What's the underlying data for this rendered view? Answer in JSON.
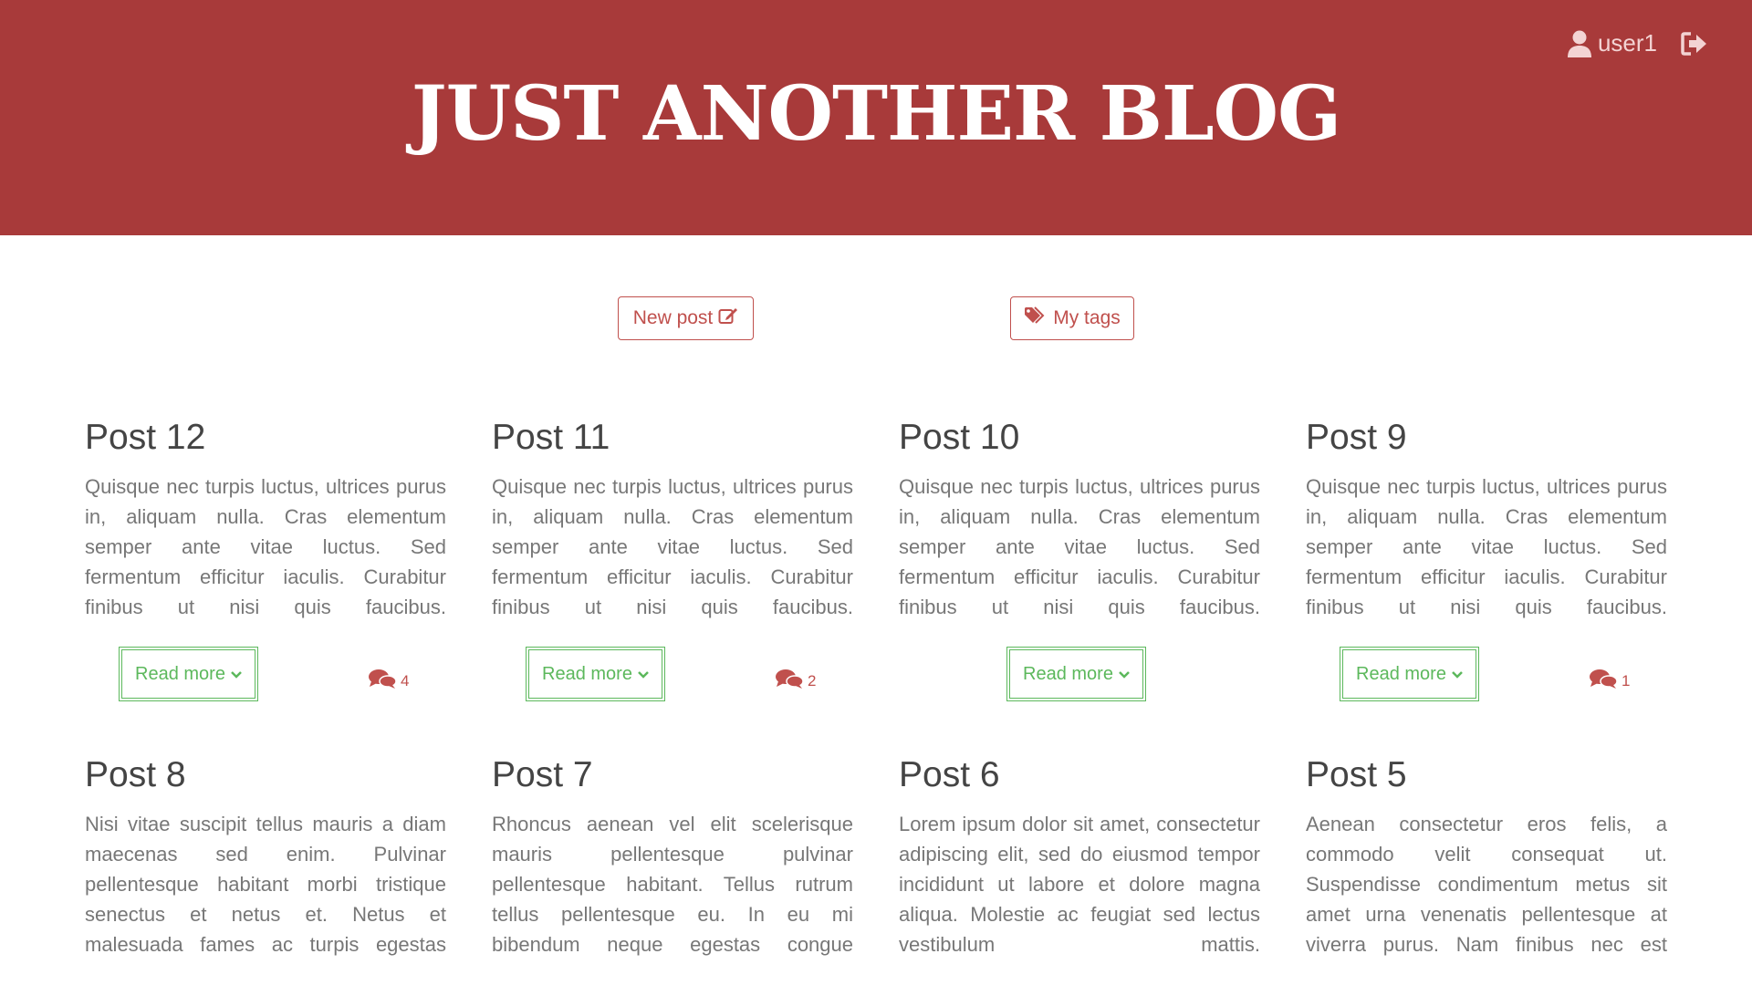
{
  "header": {
    "title": "JUST ANOTHER BLOG",
    "username": "user1",
    "background": "#a83a3a"
  },
  "actions": {
    "new_post_label": "New post",
    "my_tags_label": "My tags"
  },
  "colors": {
    "accent": "#c0504d",
    "read_more": "#5cb85c"
  },
  "posts": [
    {
      "title": "Post 12",
      "body": "Quisque nec turpis luctus, ultrices purus in, aliquam nulla. Cras elementum semper ante vitae luctus. Sed fermentum efficitur iaculis. Curabitur finibus ut nisi quis faucibus.",
      "read_more": "Read more",
      "comments": "4"
    },
    {
      "title": "Post 11",
      "body": "Quisque nec turpis luctus, ultrices purus in, aliquam nulla. Cras elementum semper ante vitae luctus. Sed fermentum efficitur iaculis. Curabitur finibus ut nisi quis faucibus.",
      "read_more": "Read more",
      "comments": "2"
    },
    {
      "title": "Post 10",
      "body": "Quisque nec turpis luctus, ultrices purus in, aliquam nulla. Cras elementum semper ante vitae luctus. Sed fermentum efficitur iaculis. Curabitur finibus ut nisi quis faucibus.",
      "read_more": "Read more",
      "comments": ""
    },
    {
      "title": "Post 9",
      "body": "Quisque nec turpis luctus, ultrices purus in, aliquam nulla. Cras elementum semper ante vitae luctus. Sed fermentum efficitur iaculis. Curabitur finibus ut nisi quis faucibus.",
      "read_more": "Read more",
      "comments": "1"
    },
    {
      "title": "Post 8",
      "body": "Nisi vitae suscipit tellus mauris a diam maecenas sed enim. Pulvinar pellentesque habitant morbi tristique senectus et netus et. Netus et malesuada fames ac turpis egestas"
    },
    {
      "title": "Post 7",
      "body": "Rhoncus aenean vel elit scelerisque mauris pellentesque pulvinar pellentesque habitant. Tellus rutrum tellus pellentesque eu. In eu mi bibendum neque egestas congue"
    },
    {
      "title": "Post 6",
      "body": "Lorem ipsum dolor sit amet, consectetur adipiscing elit, sed do eiusmod tempor incididunt ut labore et dolore magna aliqua. Molestie ac feugiat sed lectus vestibulum mattis."
    },
    {
      "title": "Post 5",
      "body": "Aenean consectetur eros felis, a commodo velit consequat ut. Suspendisse condimentum metus sit amet urna venenatis pellentesque at viverra purus. Nam finibus nec est"
    }
  ]
}
